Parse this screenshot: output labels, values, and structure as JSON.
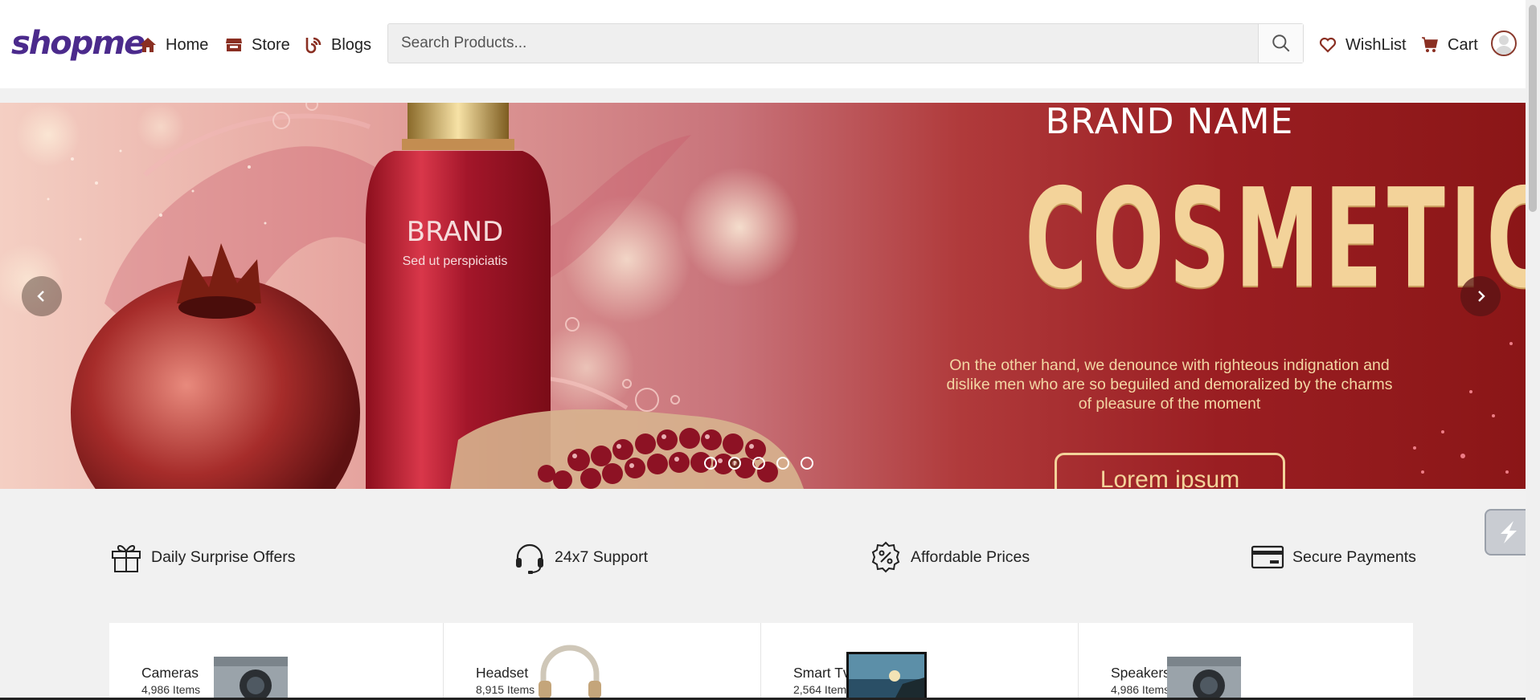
{
  "header": {
    "logo": "shopme",
    "nav": [
      {
        "label": "Home",
        "icon": "home-icon"
      },
      {
        "label": "Store",
        "icon": "store-icon"
      },
      {
        "label": "Blogs",
        "icon": "blog-icon"
      }
    ],
    "search": {
      "placeholder": "Search Products...",
      "value": ""
    },
    "wishlist_label": "WishList",
    "cart_label": "Cart"
  },
  "banner": {
    "brand_name": "BRAND NAME",
    "headline": "COSMETIC",
    "bottle_brand": "BRAND",
    "bottle_tagline": "Sed ut perspiciatis",
    "body": "On the other hand, we denounce with righteous indignation and dislike men who are so beguiled and demoralized by the charms of pleasure of the moment",
    "cta_label": "Lorem ipsum",
    "slide_count": 5,
    "active_slide": 2
  },
  "services": [
    {
      "label": "Daily Surprise Offers",
      "icon": "gift-icon"
    },
    {
      "label": "24x7 Support",
      "icon": "headset-icon"
    },
    {
      "label": "Affordable Prices",
      "icon": "discount-badge-icon"
    },
    {
      "label": "Secure Payments",
      "icon": "credit-card-icon"
    }
  ],
  "categories": [
    {
      "name": "Cameras",
      "count": "4,986 Items"
    },
    {
      "name": "Headset",
      "count": "8,915 Items"
    },
    {
      "name": "Smart Tvs",
      "count": "2,564 Items"
    },
    {
      "name": "Speakers",
      "count": "4,986 Items"
    }
  ],
  "colors": {
    "brand": "#4b2a8c",
    "nav_icon": "#8a2f22",
    "banner_dark": "#8b1617",
    "banner_gold": "#f3d39a"
  }
}
